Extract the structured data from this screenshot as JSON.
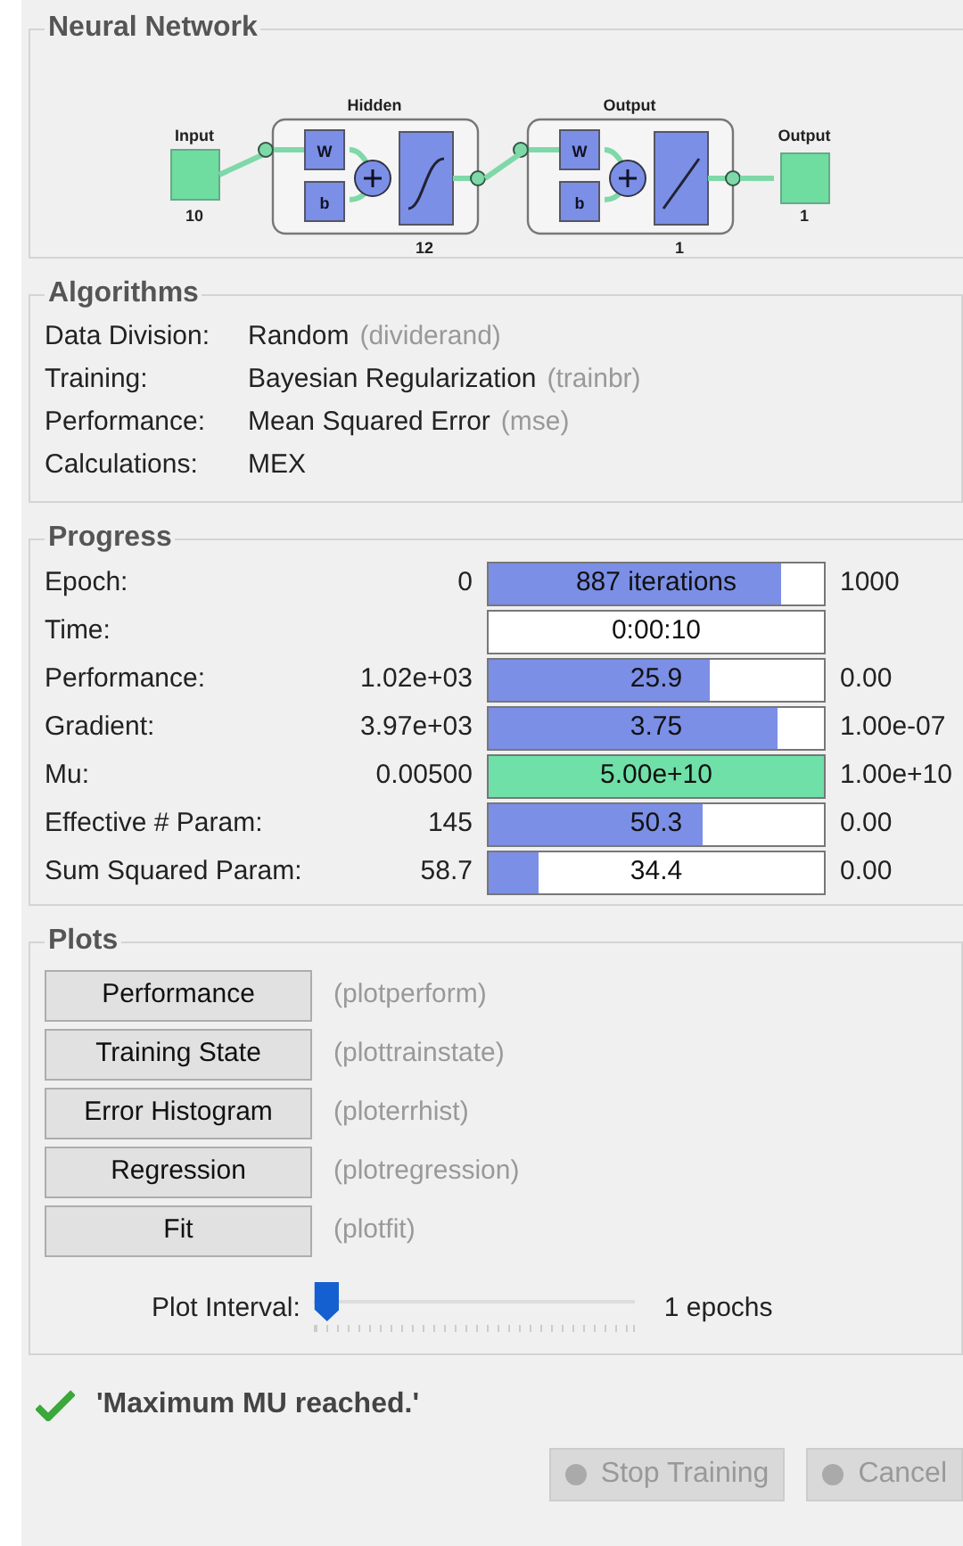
{
  "network": {
    "title": "Neural Network",
    "input": {
      "label": "Input",
      "size": "10"
    },
    "layers": [
      {
        "label": "Hidden",
        "size": "12",
        "kind": "sigmoid",
        "weight": "W",
        "bias": "b"
      },
      {
        "label": "Output",
        "size": "1",
        "kind": "linear",
        "weight": "W",
        "bias": "b"
      }
    ],
    "output": {
      "label": "Output",
      "size": "1"
    }
  },
  "algorithms": {
    "title": "Algorithms",
    "rows": [
      {
        "label": "Data Division:",
        "value": "Random",
        "function": "(dividerand)"
      },
      {
        "label": "Training:",
        "value": "Bayesian Regularization",
        "function": "(trainbr)"
      },
      {
        "label": "Performance:",
        "value": "Mean Squared Error",
        "function": "(mse)"
      },
      {
        "label": "Calculations:",
        "value": "MEX"
      }
    ]
  },
  "progress": {
    "title": "Progress",
    "rows": [
      {
        "label": "Epoch:",
        "start": "0",
        "reading": "887 iterations",
        "level": 0.87,
        "color": "#7b8fe6",
        "end": "1000"
      },
      {
        "label": "Time:",
        "reading": "0:00:10"
      },
      {
        "label": "Performance:",
        "start": "1.02e+03",
        "reading": "25.9",
        "level": 0.66,
        "color": "#7b8fe6",
        "end": "0.00"
      },
      {
        "label": "Gradient:",
        "start": "3.97e+03",
        "reading": "3.75",
        "level": 0.86,
        "color": "#7b8fe6",
        "end": "1.00e-07"
      },
      {
        "label": "Mu:",
        "start": "0.00500",
        "reading": "5.00e+10",
        "level": 1,
        "color": "#6fe0a8",
        "end": "1.00e+10"
      },
      {
        "label": "Effective # Param:",
        "start": "145",
        "reading": "50.3",
        "level": 0.64,
        "color": "#7b8fe6",
        "end": "0.00"
      },
      {
        "label": "Sum Squared Param:",
        "start": "58.7",
        "reading": "34.4",
        "level": 0.15,
        "color": "#7b8fe6",
        "end": "0.00"
      }
    ]
  },
  "plots": {
    "title": "Plots",
    "buttons": [
      {
        "label": "Performance",
        "function": "(plotperform)"
      },
      {
        "label": "Training State",
        "function": "(plottrainstate)"
      },
      {
        "label": "Error Histogram",
        "function": "(ploterrhist)"
      },
      {
        "label": "Regression",
        "function": "(plotregression)"
      },
      {
        "label": "Fit",
        "function": "(plotfit)"
      }
    ],
    "interval": {
      "label": "Plot Interval:",
      "level": 0,
      "reading": "1 epochs"
    }
  },
  "status": {
    "message": "'Maximum MU reached.'",
    "done": true
  },
  "buttons": [
    {
      "label": "Stop Training",
      "disabled": true
    },
    {
      "label": "Cancel",
      "disabled": true
    }
  ]
}
